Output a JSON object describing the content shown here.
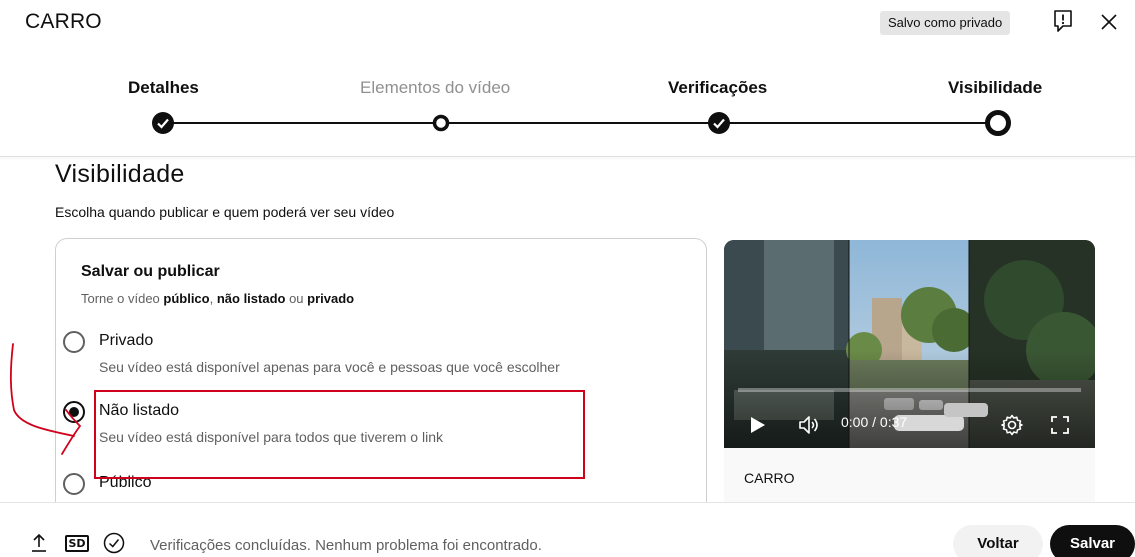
{
  "dialog": {
    "title": "CARRO",
    "saved_badge": "Salvo como privado"
  },
  "icons": [
    "feedback-icon",
    "close-icon",
    "check-icon",
    "play-icon",
    "volume-icon",
    "settings-icon",
    "fullscreen-icon",
    "upload-icon",
    "sd-icon"
  ],
  "stepper": {
    "steps": [
      {
        "label": "Detalhes",
        "state": "done"
      },
      {
        "label": "Elementos do vídeo",
        "state": "todo"
      },
      {
        "label": "Verificações",
        "state": "done"
      },
      {
        "label": "Visibilidade",
        "state": "current"
      }
    ]
  },
  "visibility": {
    "title": "Visibilidade",
    "subtitle": "Escolha quando publicar e quem poderá ver seu vídeo",
    "card": {
      "title": "Salvar ou publicar",
      "subtitle_prefix": "Torne o vídeo ",
      "subtitle_public": "público",
      "subtitle_sep1": ", ",
      "subtitle_unlisted": "não listado",
      "subtitle_sep2": " ou ",
      "subtitle_private": "privado"
    },
    "options": [
      {
        "label": "Privado",
        "description": "Seu vídeo está disponível apenas para você e pessoas que você escolher",
        "selected": false
      },
      {
        "label": "Não listado",
        "description": "Seu vídeo está disponível para todos que tiverem o link",
        "selected": true
      },
      {
        "label": "Público",
        "description": "",
        "selected": false
      }
    ]
  },
  "preview": {
    "time": "0:00 / 0:37",
    "video_title": "CARRO"
  },
  "footer": {
    "sd_label": "SD",
    "status": "Verificações concluídas. Nenhum problema foi encontrado.",
    "back_label": "Voltar",
    "save_label": "Salvar"
  },
  "colors": {
    "annotation": "#d0021b",
    "text_primary": "#0f0f0f",
    "text_secondary": "#606060",
    "text_disabled": "#909090"
  }
}
